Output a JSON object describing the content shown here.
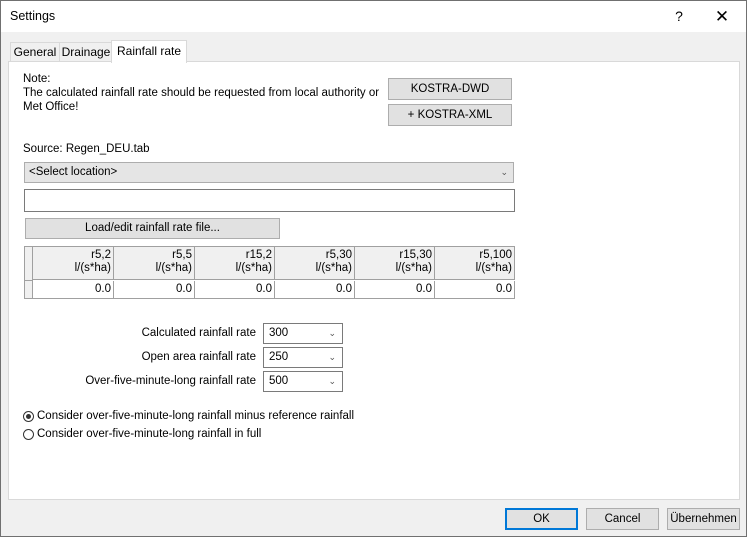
{
  "window": {
    "title": "Settings",
    "help_glyph": "?",
    "close_glyph": "✕"
  },
  "tabs": [
    {
      "label": "General",
      "active": false
    },
    {
      "label": "Drainage",
      "active": false
    },
    {
      "label": "Rainfall rate",
      "active": true
    }
  ],
  "rainfall": {
    "note_title": "Note:",
    "note_text": "The calculated rainfall rate should be requested from local authority or Met Office!",
    "kostra_dwd_button": "KOSTRA-DWD",
    "kostra_xml_button": "+ KOSTRA-XML",
    "source_label": "Source: Regen_DEU.tab",
    "location_select": {
      "value": "<Select location>",
      "icon": "chevron-down-icon"
    },
    "location_text": {
      "value": ""
    },
    "load_button": "Load/edit rainfall rate file...",
    "grid": {
      "columns": [
        {
          "name": "r5,2",
          "unit": "l/(s*ha)"
        },
        {
          "name": "r5,5",
          "unit": "l/(s*ha)"
        },
        {
          "name": "r15,2",
          "unit": "l/(s*ha)"
        },
        {
          "name": "r5,30",
          "unit": "l/(s*ha)"
        },
        {
          "name": "r15,30",
          "unit": "l/(s*ha)"
        },
        {
          "name": "r5,100",
          "unit": "l/(s*ha)"
        }
      ],
      "rows": [
        [
          "0.0",
          "0.0",
          "0.0",
          "0.0",
          "0.0",
          "0.0"
        ]
      ]
    },
    "rates": [
      {
        "label": "Calculated rainfall rate",
        "value": "300"
      },
      {
        "label": "Open area rainfall rate",
        "value": "250"
      },
      {
        "label": "Over-five-minute-long rainfall rate",
        "value": "500"
      }
    ],
    "options": [
      {
        "label": "Consider over-five-minute-long rainfall minus reference rainfall",
        "checked": true
      },
      {
        "label": "Consider over-five-minute-long rainfall in full",
        "checked": false
      }
    ]
  },
  "footer": {
    "ok": "OK",
    "cancel": "Cancel",
    "apply": "Übernehmen"
  },
  "colors": {
    "focus_border": "#0078d7",
    "dialog_bg": "#f0f0f0",
    "button_bg": "#e1e1e1"
  }
}
